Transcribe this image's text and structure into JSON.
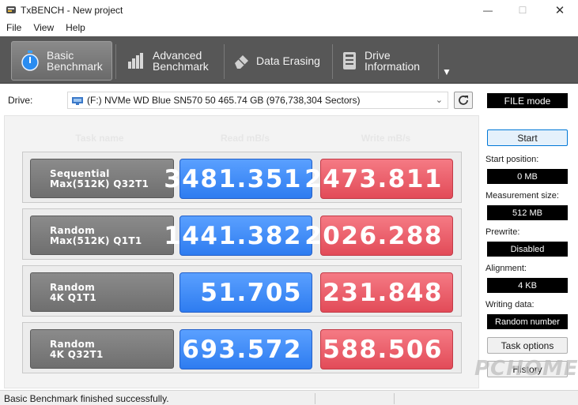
{
  "window": {
    "title": "TxBENCH - New project",
    "min_glyph": "—",
    "max_glyph": "☐",
    "close_glyph": "✕"
  },
  "menu": [
    "File",
    "View",
    "Help"
  ],
  "toolbar": {
    "tabs": [
      {
        "line1": "Basic",
        "line2": "Benchmark",
        "icon": "stopwatch-icon",
        "active": true
      },
      {
        "line1": "Advanced",
        "line2": "Benchmark",
        "icon": "bar-chart-icon",
        "active": false
      },
      {
        "line1": "Data Erasing",
        "line2": "",
        "icon": "eraser-icon",
        "active": false
      },
      {
        "line1": "Drive",
        "line2": "Information",
        "icon": "drive-info-icon",
        "active": false
      }
    ],
    "more_glyph": "▼"
  },
  "drive": {
    "label": "Drive:",
    "selected": "(F:) NVMe WD Blue SN570 50  465.74 GB (976,738,304 Sectors)",
    "mode": "FILE mode"
  },
  "table": {
    "headers": {
      "task": "Task name",
      "read": "Read mB/s",
      "write": "Write mB/s"
    },
    "rows": [
      {
        "name1": "Sequential",
        "name2": "Max(512K) Q32T1",
        "read": "3481.351",
        "write": "2473.811"
      },
      {
        "name1": "Random",
        "name2": "Max(512K) Q1T1",
        "read": "1441.382",
        "write": "2026.288"
      },
      {
        "name1": "Random",
        "name2": "4K Q1T1",
        "read": "51.705",
        "write": "231.848"
      },
      {
        "name1": "Random",
        "name2": "4K Q32T1",
        "read": "693.572",
        "write": "588.506"
      }
    ]
  },
  "side": {
    "start": "Start",
    "start_position_label": "Start position:",
    "start_position": "0 MB",
    "measurement_size_label": "Measurement size:",
    "measurement_size": "512 MB",
    "prewrite_label": "Prewrite:",
    "prewrite": "Disabled",
    "alignment_label": "Alignment:",
    "alignment": "4 KB",
    "writing_data_label": "Writing data:",
    "writing_data": "Random number",
    "task_options": "Task options",
    "history": "History"
  },
  "status": {
    "message": "Basic Benchmark finished successfully."
  },
  "watermark": "PCHOME",
  "colors": {
    "read_blue": "#2e7cf0",
    "write_red": "#e24b58",
    "toolbar_bg": "#575757",
    "accent": "#0078d7"
  }
}
